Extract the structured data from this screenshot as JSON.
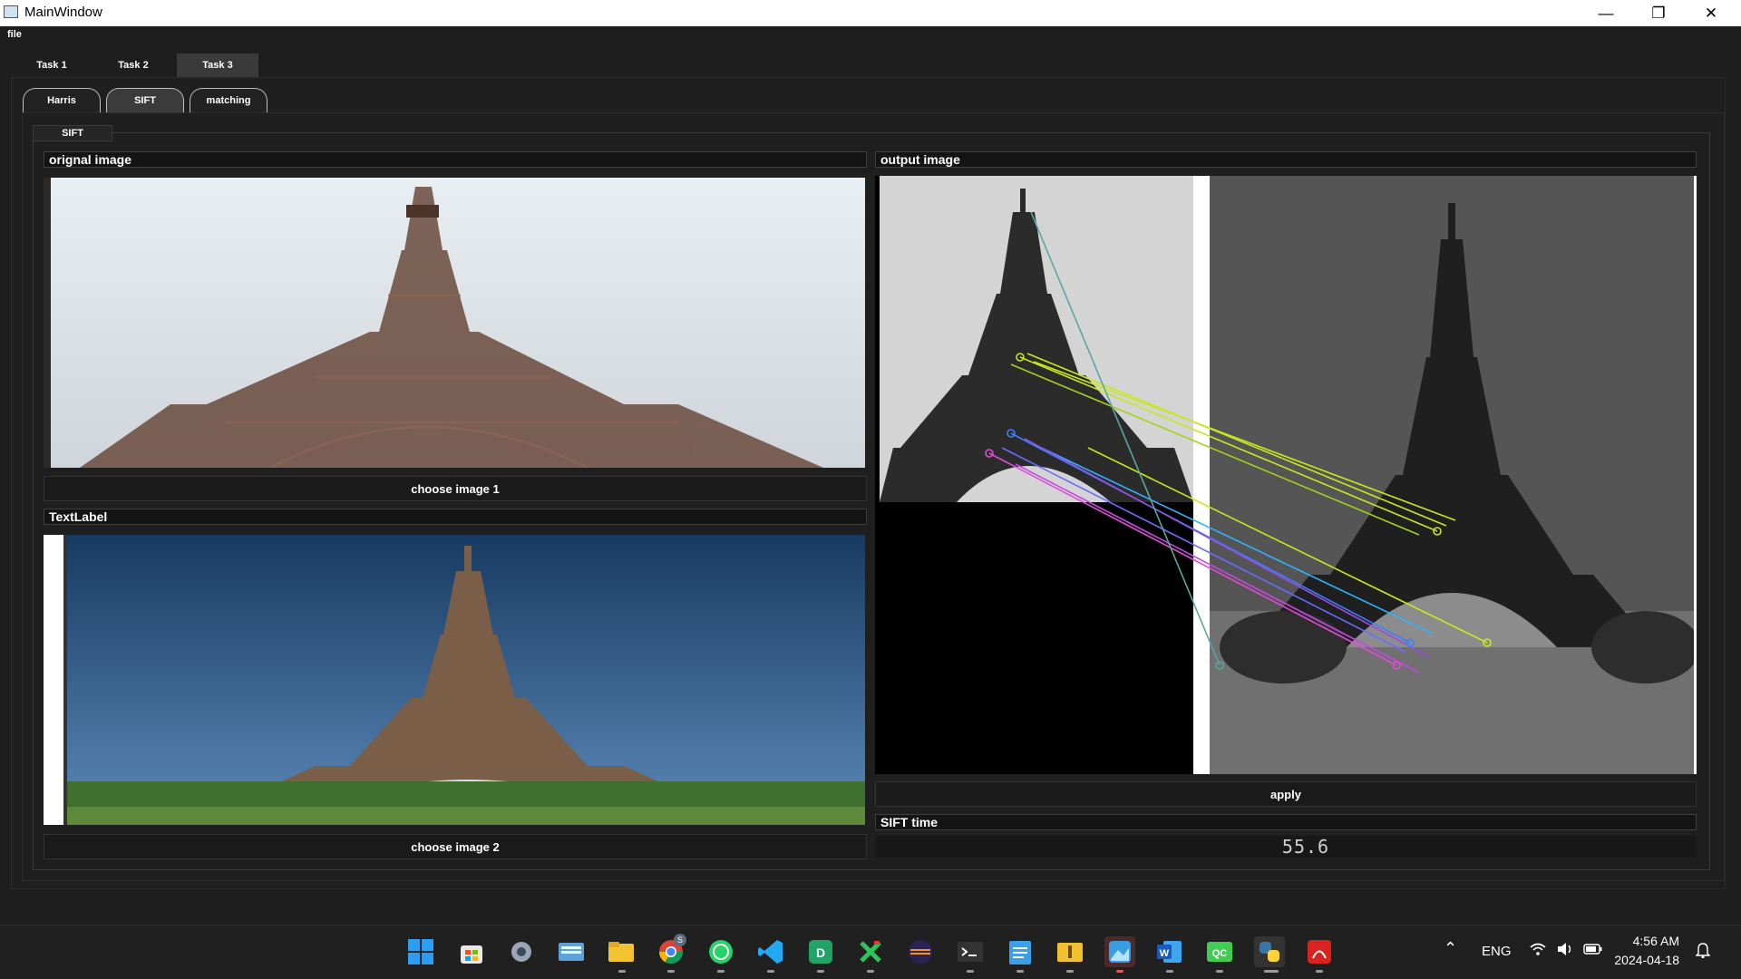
{
  "window": {
    "title": "MainWindow",
    "minimize": "—",
    "maximize": "❐",
    "close": "✕"
  },
  "menu": {
    "file": "file"
  },
  "outer_tabs": [
    "Task 1",
    "Task 2",
    "Task 3"
  ],
  "outer_active": "Task 3",
  "inner_tabs": [
    "Harris",
    "SIFT",
    "matching"
  ],
  "inner_active": "SIFT",
  "group": {
    "title": "SIFT"
  },
  "left": {
    "original_header": "orignal image",
    "choose1": "choose image 1",
    "label2_header": "TextLabel",
    "choose2": "choose image 2"
  },
  "right": {
    "output_header": "output image",
    "apply": "apply",
    "time_header": "SIFT time",
    "time_value": "55.6"
  },
  "taskbar": {
    "apps": [
      "start",
      "store",
      "settings",
      "keyboard",
      "files",
      "chrome",
      "whatsapp",
      "vscode",
      "desktop-d",
      "x-app",
      "eclipse",
      "terminal",
      "notepad",
      "archive",
      "photos",
      "word",
      "qc",
      "python",
      "acrobat"
    ],
    "chrome_badge": "S",
    "lang": "ENG",
    "time": "4:56 AM",
    "date": "2024-04-18"
  },
  "colors": {
    "accent": "#3a3a3a",
    "match_lines": [
      "#c7e81e",
      "#3a82ff",
      "#e34ad6",
      "#5aa79c",
      "#2fb3ff"
    ]
  }
}
